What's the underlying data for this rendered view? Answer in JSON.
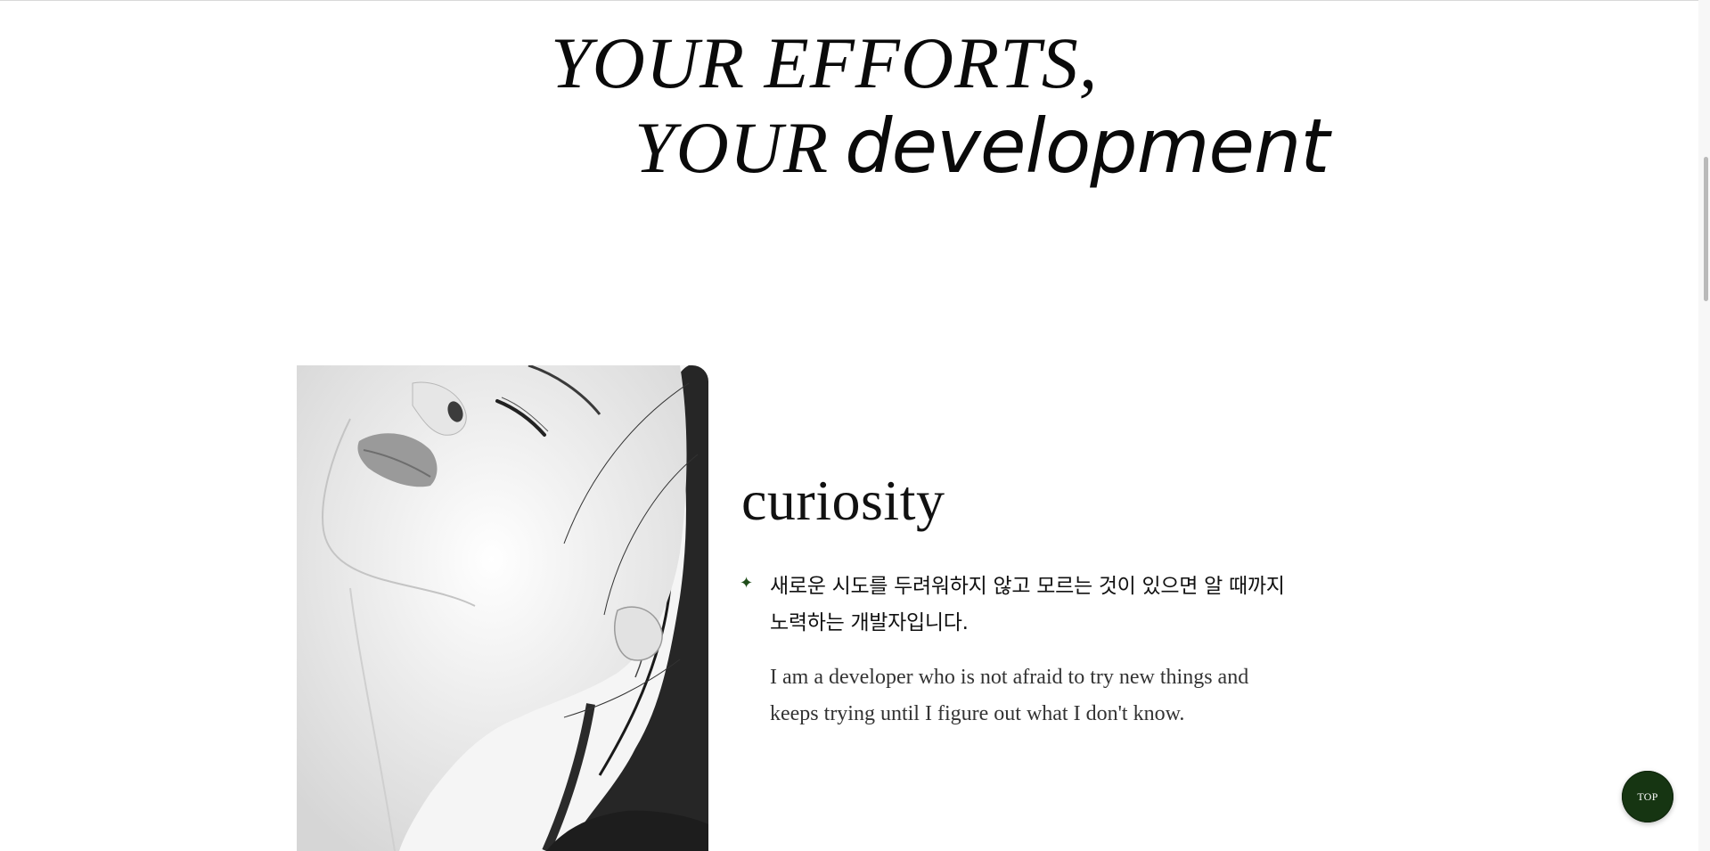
{
  "hero": {
    "line1": "YOUR EFFORTS,",
    "line2_serif": "YOUR",
    "line2_sans": "development"
  },
  "section": {
    "title": "curiosity",
    "bullet_icon": "✦",
    "korean": "새로운 시도를 두려워하지 않고 모르는 것이 있으면 알 때까지 노력하는 개발자입니다.",
    "english": "I am a developer who is not afraid to try new things and keeps trying until I figure out what I don't know."
  },
  "top_button": {
    "label": "TOP"
  },
  "colors": {
    "accent_green": "#163512",
    "bullet_green": "#1f4d1a"
  }
}
